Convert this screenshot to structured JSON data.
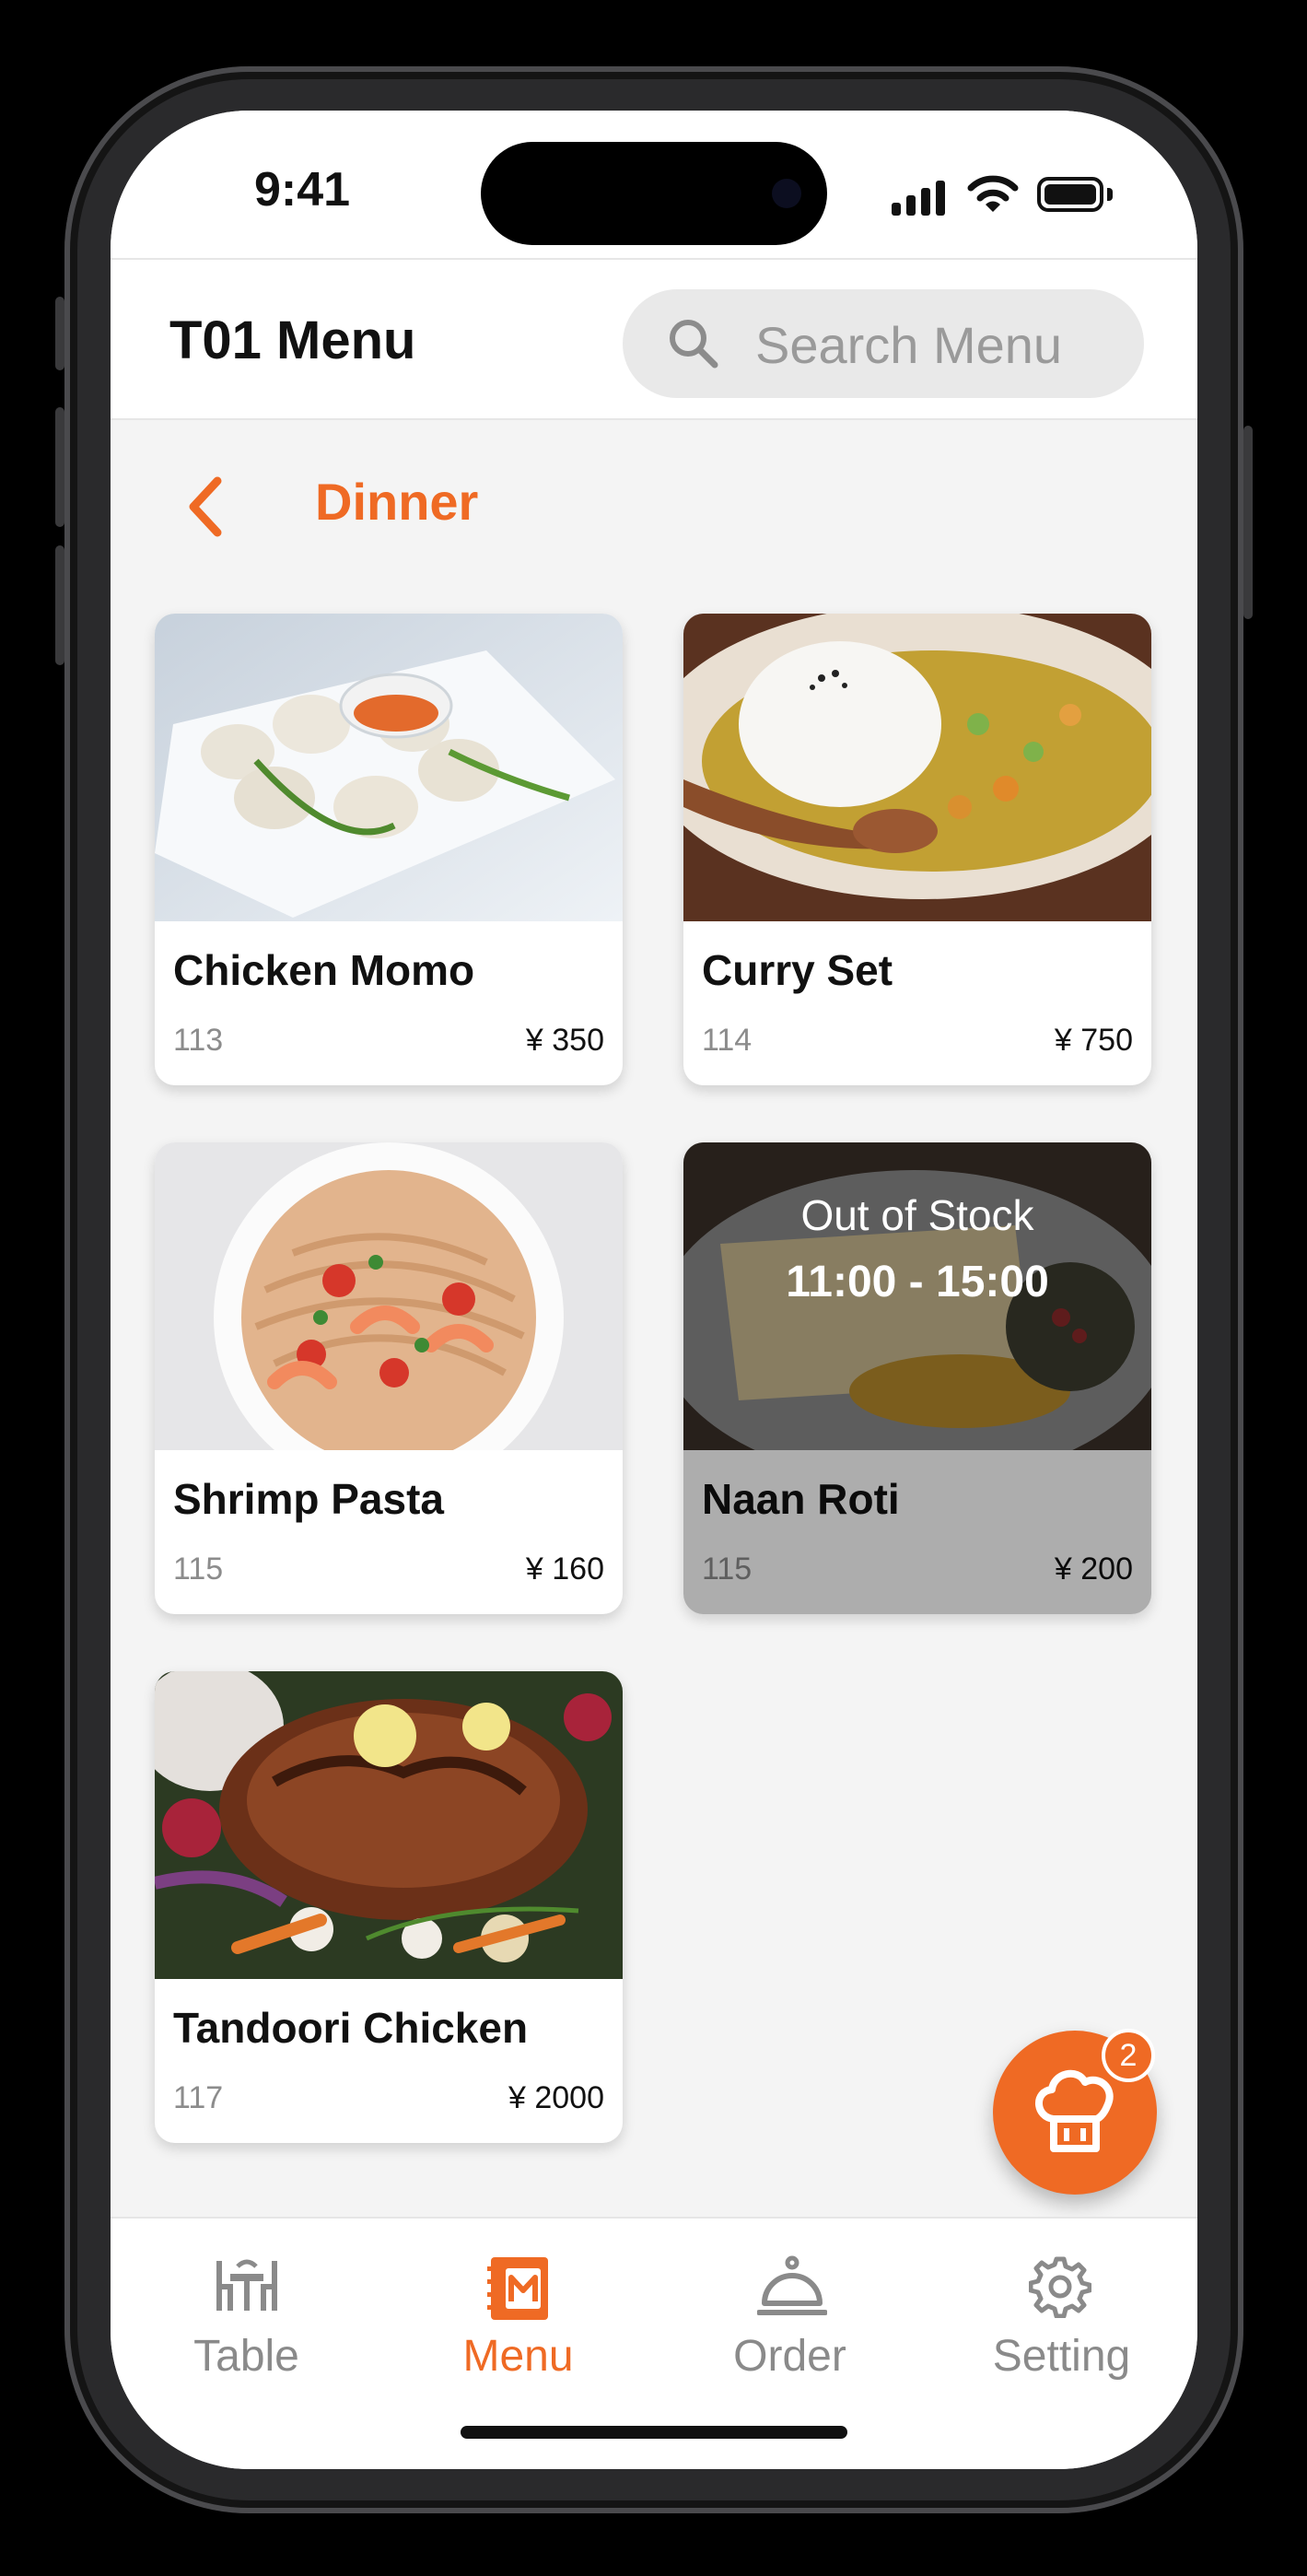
{
  "status_bar": {
    "time": "9:41"
  },
  "header": {
    "title": "T01 Menu",
    "search_placeholder": "Search Menu"
  },
  "category": {
    "title": "Dinner"
  },
  "items": [
    {
      "name": "Chicken Momo",
      "code": "113",
      "price": "¥ 350",
      "image": "dumplings-photo"
    },
    {
      "name": "Curry Set",
      "code": "114",
      "price": "¥ 750",
      "image": "curry-rice-photo"
    },
    {
      "name": "Shrimp Pasta",
      "code": "115",
      "price": "¥ 160",
      "image": "shrimp-pasta-photo"
    },
    {
      "name": "Naan Roti",
      "code": "115",
      "price": "¥ 200",
      "image": "naan-photo",
      "out_of_stock": true,
      "stock_label": "Out of Stock",
      "stock_hours": "11:00 - 15:00"
    },
    {
      "name": "Tandoori Chicken",
      "code": "117",
      "price": "¥ 2000",
      "image": "roast-chicken-photo"
    }
  ],
  "order_fab": {
    "icon": "chef-hat-icon",
    "count": "2"
  },
  "tabs": [
    {
      "label": "Table",
      "icon": "table-icon",
      "active": false
    },
    {
      "label": "Menu",
      "icon": "menu-book-icon",
      "active": true
    },
    {
      "label": "Order",
      "icon": "bell-icon",
      "active": false
    },
    {
      "label": "Setting",
      "icon": "gear-icon",
      "active": false
    }
  ],
  "colors": {
    "accent": "#EF6A24",
    "background": "#F4F4F4",
    "inactive": "#8A8A8A"
  }
}
